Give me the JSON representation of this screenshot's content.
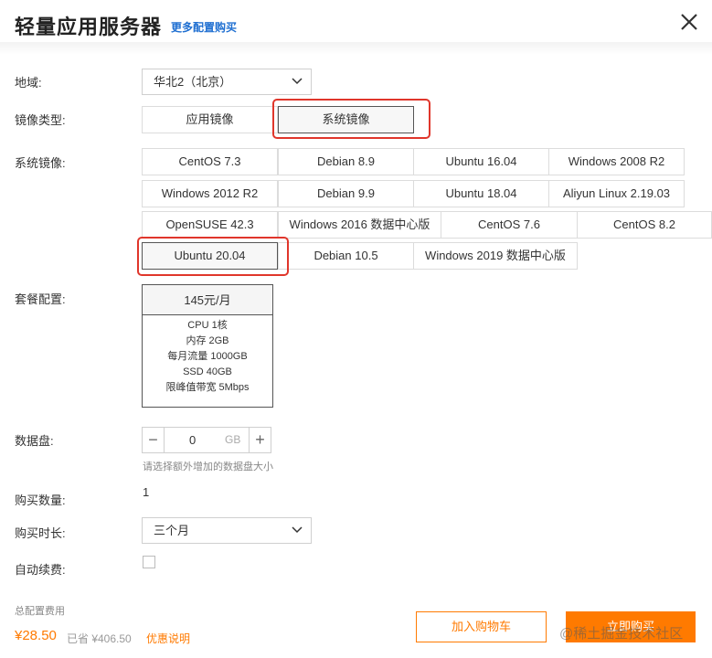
{
  "header": {
    "title": "轻量应用服务器",
    "more_link": "更多配置购买",
    "close_icon": "close-icon"
  },
  "region": {
    "label": "地域:",
    "value": "华北2（北京）"
  },
  "image_type": {
    "label": "镜像类型:",
    "options": [
      "应用镜像",
      "系统镜像"
    ],
    "selected": "系统镜像"
  },
  "system_image": {
    "label": "系统镜像:",
    "options": [
      "CentOS 7.3",
      "Debian 8.9",
      "Ubuntu 16.04",
      "Windows 2008 R2",
      "Windows 2012 R2",
      "Debian 9.9",
      "Ubuntu 18.04",
      "Aliyun Linux 2.19.03",
      "OpenSUSE 42.3",
      "Windows 2016 数据中心版",
      "CentOS 7.6",
      "CentOS 8.2",
      "Ubuntu 20.04",
      "Debian 10.5",
      "Windows 2019 数据中心版"
    ],
    "selected": "Ubuntu 20.04"
  },
  "plan": {
    "label": "套餐配置:",
    "price": "145元/月",
    "specs": [
      "CPU 1核",
      "内存 2GB",
      "每月流量 1000GB",
      "SSD 40GB",
      "限峰值带宽 5Mbps"
    ]
  },
  "disk": {
    "label": "数据盘:",
    "value": "0",
    "unit": "GB",
    "minus": "−",
    "plus": "+",
    "hint": "请选择额外增加的数据盘大小"
  },
  "quantity": {
    "label": "购买数量:",
    "value": "1"
  },
  "duration": {
    "label": "购买时长:",
    "value": "三个月"
  },
  "auto_renew": {
    "label": "自动续费:",
    "checked": false
  },
  "footer": {
    "total_label": "总配置费用",
    "price": "¥28.50",
    "saved": "已省 ¥406.50",
    "promo": "优惠说明",
    "add_cart": "加入购物车",
    "buy_now": "立即购买",
    "watermark": "@稀土掘金技术社区"
  },
  "colors": {
    "accent": "#ff7a00",
    "link": "#1f6fd1",
    "highlight": "#e0362b"
  }
}
